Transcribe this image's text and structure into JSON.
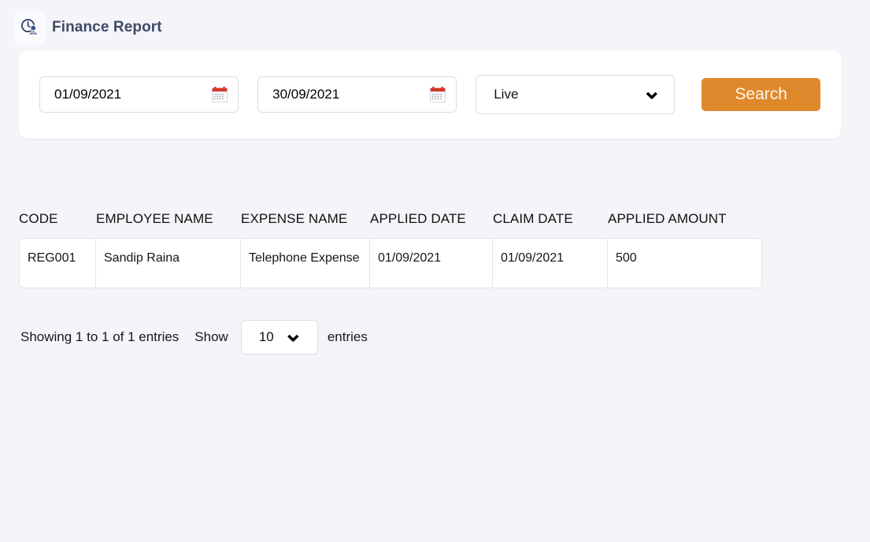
{
  "header": {
    "icon": "clock-user-icon",
    "title": "Finance Report"
  },
  "search_panel": {
    "from_date": {
      "value": "01/09/2021",
      "placeholder": "dd/mm/yyyy",
      "icon": "calendar-icon"
    },
    "to_date": {
      "value": "30/09/2021",
      "placeholder": "dd/mm/yyyy",
      "icon": "calendar-icon"
    },
    "status_select": {
      "value": "Live",
      "icon": "chevron-down-icon"
    },
    "search_button": {
      "label": "Search",
      "color": "#e0882c"
    }
  },
  "table": {
    "columns": [
      "CODE",
      "EMPLOYEE NAME",
      "EXPENSE NAME",
      "APPLIED DATE",
      "CLAIM DATE",
      "APPLIED AMOUNT"
    ],
    "rows": [
      {
        "code": "REG001",
        "employee_name": "Sandip Raina",
        "expense_name": "Telephone Expense",
        "applied_date": "01/09/2021",
        "claim_date": "01/09/2021",
        "applied_amount": "500"
      }
    ]
  },
  "footer": {
    "showing_text": "Showing 1 to 1 of 1 entries",
    "show_label": "Show",
    "entries_value": "10",
    "entries_label": "entries",
    "chevron_icon": "chevron-down-icon"
  },
  "colors": {
    "page_background": "#f4f4f9",
    "card_background": "#ffffff",
    "title_text": "#3f4a66",
    "accent_orange": "#e0882c",
    "calendar_red": "#d9362b",
    "border": "#dcdce3"
  }
}
